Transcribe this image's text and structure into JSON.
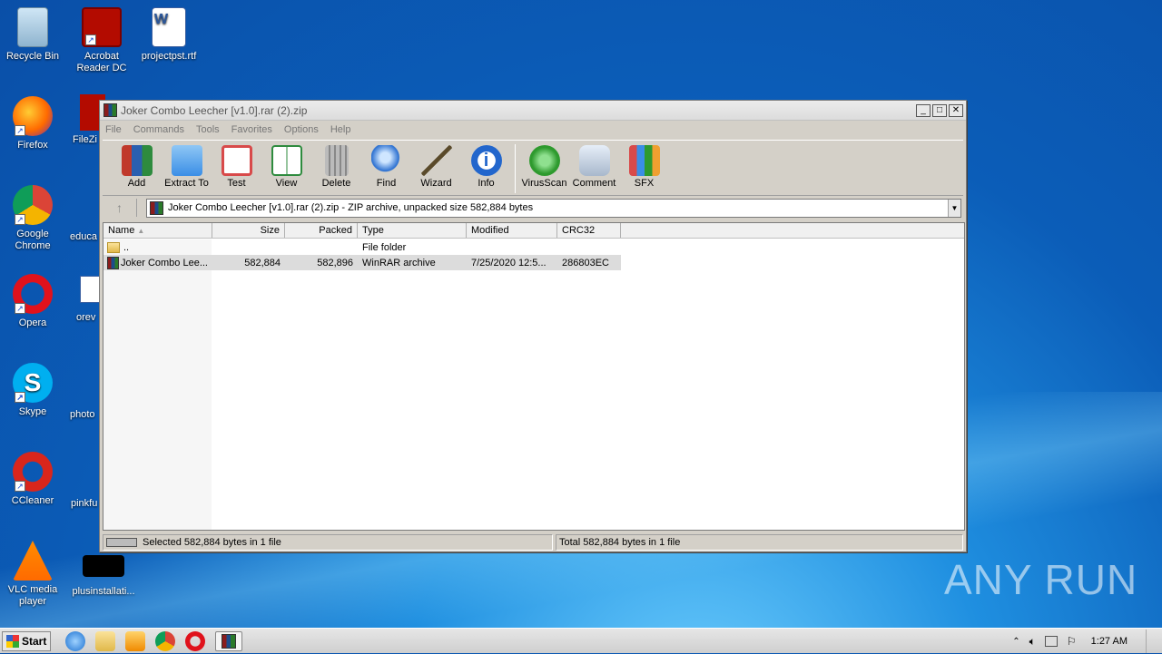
{
  "desktop": {
    "icons": [
      {
        "label": "Recycle Bin",
        "icon": "recycle-bin-icon"
      },
      {
        "label": "Acrobat Reader DC",
        "icon": "acrobat-icon"
      },
      {
        "label": "projectpst.rtf",
        "icon": "word-doc-icon"
      },
      {
        "label": "Firefox",
        "icon": "firefox-icon"
      },
      {
        "label": "FileZi",
        "icon": "filezilla-icon"
      },
      {
        "label": "Google Chrome",
        "icon": "chrome-icon"
      },
      {
        "label": "educa",
        "icon": "file-icon"
      },
      {
        "label": "Opera",
        "icon": "opera-icon"
      },
      {
        "label": "orev",
        "icon": "word-doc-icon"
      },
      {
        "label": "Skype",
        "icon": "skype-icon"
      },
      {
        "label": "photo",
        "icon": "file-icon"
      },
      {
        "label": "CCleaner",
        "icon": "ccleaner-icon"
      },
      {
        "label": "pinkfu",
        "icon": "file-icon"
      },
      {
        "label": "VLC media player",
        "icon": "vlc-icon"
      },
      {
        "label": "plusinstallati...",
        "icon": "exe-icon"
      }
    ]
  },
  "window": {
    "title": "Joker Combo Leecher [v1.0].rar (2).zip",
    "menu": [
      "File",
      "Commands",
      "Tools",
      "Favorites",
      "Options",
      "Help"
    ],
    "toolbar": [
      {
        "label": "Add",
        "icon": "add-archive-icon",
        "color": "#c0392b"
      },
      {
        "label": "Extract To",
        "icon": "folder-icon",
        "color": "#3a8ee6"
      },
      {
        "label": "Test",
        "icon": "test-clipboard-icon",
        "color": "#d84a4a"
      },
      {
        "label": "View",
        "icon": "book-icon",
        "color": "#2e8b3e"
      },
      {
        "label": "Delete",
        "icon": "trash-icon",
        "color": "#8a8a8a"
      },
      {
        "label": "Find",
        "icon": "magnifier-icon",
        "color": "#2a6fd0"
      },
      {
        "label": "Wizard",
        "icon": "wand-icon",
        "color": "#9a7a3a"
      },
      {
        "label": "Info",
        "icon": "info-icon",
        "color": "#2266cc"
      },
      {
        "label": "VirusScan",
        "icon": "virus-scan-icon",
        "color": "#2e9a2e"
      },
      {
        "label": "Comment",
        "icon": "comment-icon",
        "color": "#7a8aa0"
      },
      {
        "label": "SFX",
        "icon": "sfx-icon",
        "color": "#c04a8a"
      }
    ],
    "address": "Joker Combo Leecher [v1.0].rar (2).zip - ZIP archive, unpacked size 582,884 bytes",
    "columns": [
      "Name",
      "Size",
      "Packed",
      "Type",
      "Modified",
      "CRC32"
    ],
    "rows": [
      {
        "name": "..",
        "size": "",
        "packed": "",
        "type": "File folder",
        "modified": "",
        "crc": ""
      },
      {
        "name": "Joker Combo Lee...",
        "size": "582,884",
        "packed": "582,896",
        "type": "WinRAR archive",
        "modified": "7/25/2020 12:5...",
        "crc": "286803EC"
      }
    ],
    "status_left": "Selected 582,884 bytes in 1 file",
    "status_right": "Total 582,884 bytes in 1 file"
  },
  "taskbar": {
    "start_label": "Start",
    "clock": "1:27 AM"
  },
  "watermark": "ANY RUN"
}
